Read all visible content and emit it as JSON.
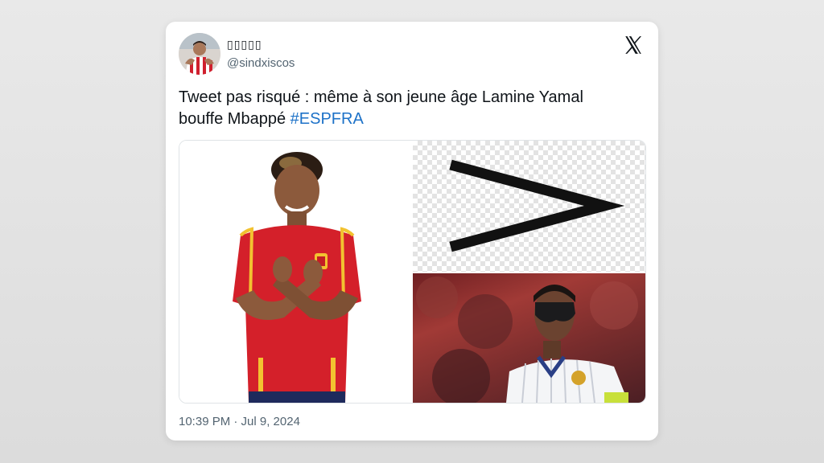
{
  "user": {
    "display_name": "▯▯▯▯▯",
    "handle": "@sindxiscos"
  },
  "tweet": {
    "text_line1": "Tweet pas risqué : même à son jeune âge Lamine Yamal",
    "text_line2": "bouffe Mbappé ",
    "hashtag": "#ESPFRA",
    "timestamp": "10:39 PM · Jul 9, 2024"
  },
  "colors": {
    "hashtag": "#1d72c8",
    "spain_red": "#d4202a",
    "spain_yellow": "#f2c230"
  },
  "icons": {
    "brand": "x-logo-icon",
    "comparison": "greater-than-symbol"
  }
}
